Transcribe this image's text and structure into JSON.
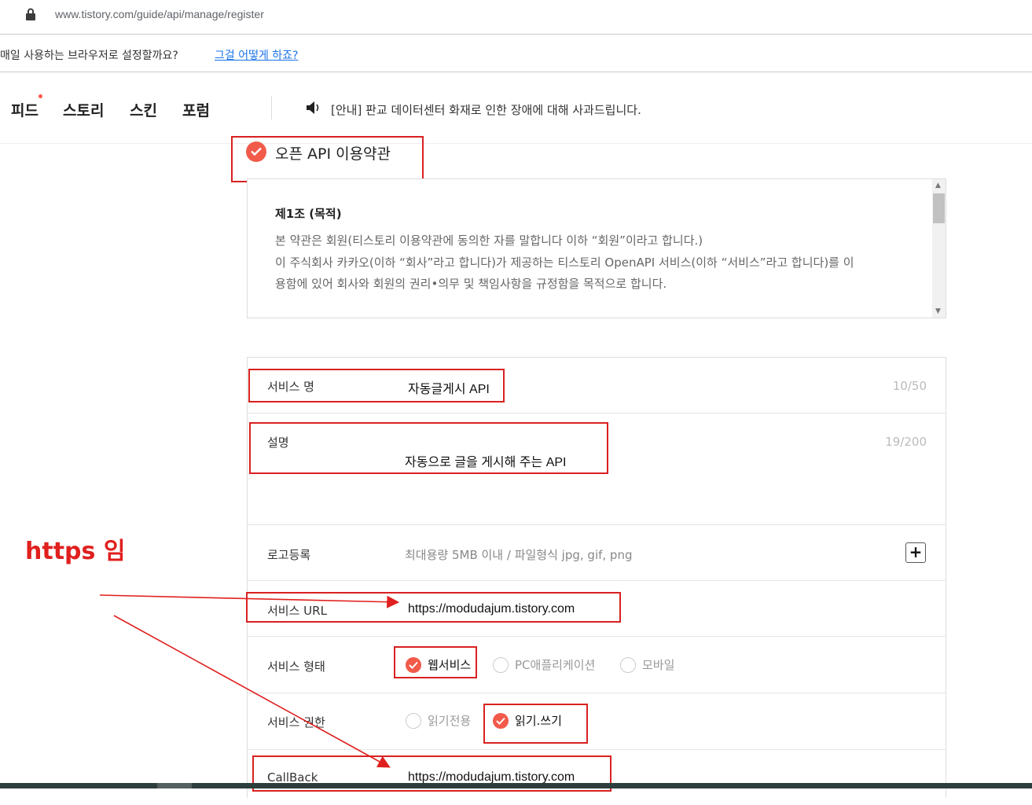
{
  "browser": {
    "url": "www.tistory.com/guide/api/manage/register"
  },
  "infobar": {
    "question": "매일 사용하는 브라우저로 설정할까요?",
    "link": "그걸 어떻게 하죠?"
  },
  "nav": {
    "items": [
      "피드",
      "스토리",
      "스킨",
      "포럼"
    ],
    "notice": "[안내] 판교 데이터센터 화재로 인한 장애에 대해 사과드립니다."
  },
  "terms": {
    "title": "오픈 API 이용약관",
    "article_title": "제1조 (목적)",
    "lines": [
      "본 약관은 회원(티스토리 이용약관에 동의한 자를 말합니다 이하 “회원”이라고 합니다.)",
      "이 주식회사 카카오(이하 “회사”라고 합니다)가 제공하는 티스토리 OpenAPI 서비스(이하 “서비스”라고 합니다)를 이",
      "용함에 있어 회사와 회원의 권리•의무 및 책임사항을 규정함을 목적으로 합니다."
    ]
  },
  "form": {
    "service_name": {
      "label": "서비스 명",
      "value": "자동글게시 API",
      "count": "10/50"
    },
    "description": {
      "label": "설명",
      "value": "자동으로 글을 게시해 주는 API",
      "count": "19/200"
    },
    "logo": {
      "label": "로고등록",
      "hint": "최대용량 5MB 이내 / 파일형식 jpg, gif, png",
      "plus": "+"
    },
    "service_url": {
      "label": "서비스 URL",
      "value": "https://modudajum.tistory.com"
    },
    "service_type": {
      "label": "서비스 형태",
      "options": [
        "웹서비스",
        "PC애플리케이션",
        "모바일"
      ],
      "selected": "웹서비스"
    },
    "service_permission": {
      "label": "서비스 권한",
      "options": [
        "읽기전용",
        "읽기.쓰기"
      ],
      "selected": "읽기.쓰기"
    },
    "callback": {
      "label": "CallBack",
      "value": "https://modudajum.tistory.com"
    }
  },
  "annotation": {
    "text": "https 임",
    "color": "#e0201e"
  },
  "colors": {
    "accent": "#f25a4a",
    "highlight_box": "#d92121"
  }
}
